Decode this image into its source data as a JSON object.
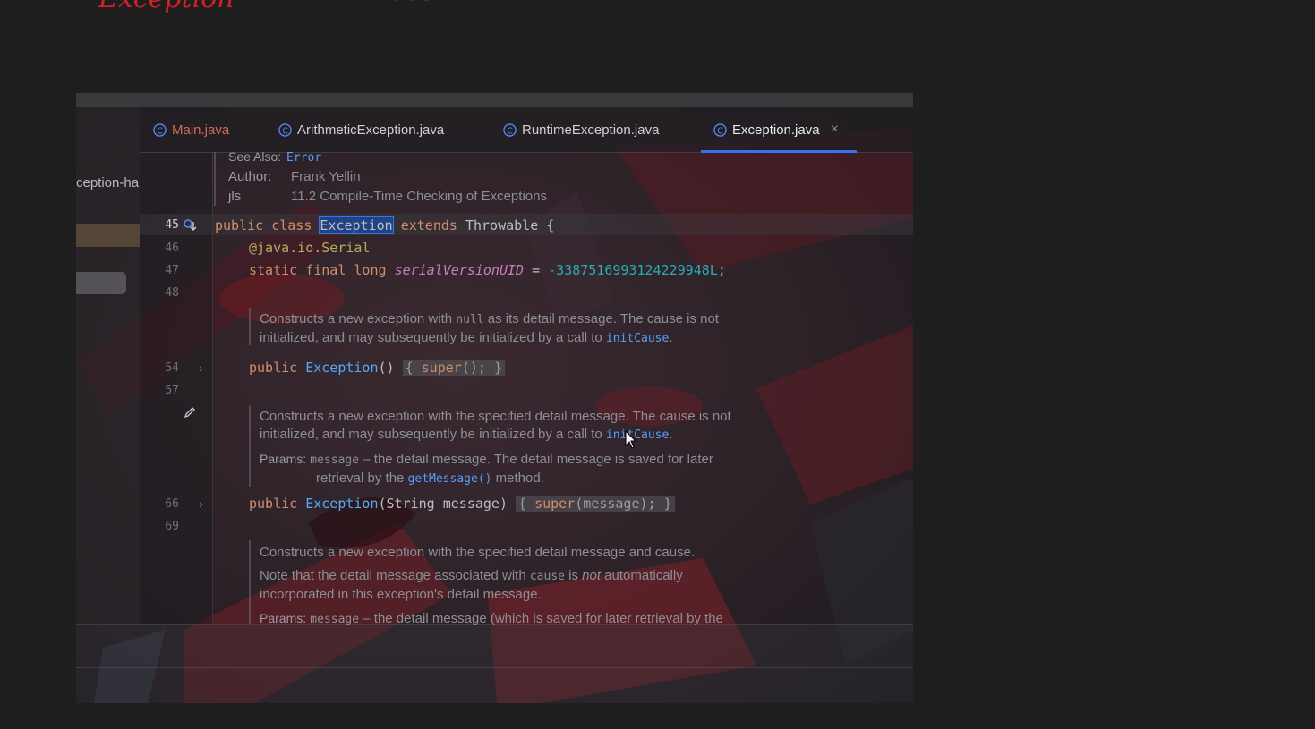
{
  "handwriting": {
    "text1": "Exception",
    "text2": "Class"
  },
  "project": {
    "label": "ception-ha"
  },
  "tabs": [
    {
      "label": "Main.java",
      "color": "#d46a5a",
      "active": false
    },
    {
      "label": "ArithmeticException.java",
      "color": "#cfd1d6",
      "active": false
    },
    {
      "label": "RuntimeException.java",
      "color": "#cfd1d6",
      "active": false
    },
    {
      "label": "Exception.java",
      "color": "#e8e9ec",
      "active": true
    }
  ],
  "tab_close": "×",
  "header_doc": {
    "see_also_label": "See Also:",
    "see_also_value": "Error",
    "author_label": "Author:",
    "author_value": "Frank Yellin",
    "jls_label": "jls",
    "jls_value": "11.2 Compile-Time Checking of Exceptions"
  },
  "line_numbers": {
    "l45": "45",
    "l46": "46",
    "l47": "47",
    "l48": "48",
    "l54": "54",
    "l57": "57",
    "l66": "66",
    "l69": "69"
  },
  "code": {
    "line45": {
      "kw1": "public",
      "kw2": "class",
      "name": "Exception",
      "kw3": "extends",
      "parent": "Throwable {"
    },
    "line46": {
      "annotation": "@java.io.",
      "serial": "Serial"
    },
    "line47": {
      "kw": "static final long",
      "field": "serialVersionUID",
      "eq": " = ",
      "value": "-3387516993124229948L",
      "end": ";"
    },
    "line54": {
      "kw": "public",
      "name": "Exception",
      "params": "()",
      "body_open": "{",
      "super_kw": "super",
      "body": "();",
      "body_close": "}"
    },
    "line66": {
      "kw": "public",
      "name": "Exception",
      "params": "(String message)",
      "body_open": "{",
      "super_kw": "super",
      "body": "(message);",
      "body_close": "}"
    }
  },
  "doc1": {
    "t1": "Constructs a new exception with ",
    "null": "null",
    "t2": " as its detail message. The cause is not",
    "t3": "initialized, and may subsequently be initialized by a call to ",
    "link": "initCause",
    "t4": "."
  },
  "doc2": {
    "t1": "Constructs a new exception with the specified detail message. The cause is not",
    "t2": "initialized, and may subsequently be initialized by a call to ",
    "link": "initCause",
    "t3": ".",
    "params_label": "Params:",
    "param": "message",
    "p1": " – the detail message. The detail message is saved for later",
    "p2": "retrieval by the ",
    "getmsg": "getMessage()",
    "p3": " method."
  },
  "doc3": {
    "t1": "Constructs a new exception with the specified detail message and cause.",
    "t2a": "Note that the detail message associated with ",
    "cause": "cause",
    "t2b": " is ",
    "not": "not",
    "t2c": " automatically",
    "t3": "incorporated in this exception's detail message.",
    "params_label": "Params:",
    "param": "message",
    "p1": " – the detail message (which is saved for later retrieval by the"
  }
}
